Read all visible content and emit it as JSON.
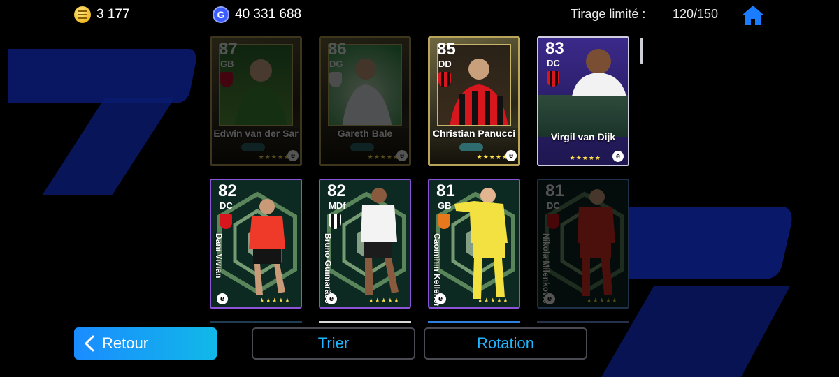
{
  "topbar": {
    "coins": "3 177",
    "gp": "40 331 688",
    "draw_label": "Tirage limité :",
    "draw_count": "120/150"
  },
  "icons": {
    "coin": "coin-icon",
    "gp": "gp-icon",
    "home": "home-icon",
    "back": "chevron-left-icon"
  },
  "cards": [
    {
      "rating": "87",
      "position": "GB",
      "name": "Edwin van der Sar",
      "style": "legend",
      "faded": true
    },
    {
      "rating": "86",
      "position": "DG",
      "name": "Gareth Bale",
      "style": "legend",
      "faded": true
    },
    {
      "rating": "85",
      "position": "DD",
      "name": "Christian Panucci",
      "style": "legend",
      "faded": false
    },
    {
      "rating": "83",
      "position": "DC",
      "name": "Virgil van Dijk",
      "style": "epic",
      "faded": false
    },
    {
      "rating": "82",
      "position": "DC",
      "name": "Dani Vivian",
      "style": "hex",
      "faded": false
    },
    {
      "rating": "82",
      "position": "MDf",
      "name": "Bruno Guimarães",
      "style": "hex",
      "faded": false
    },
    {
      "rating": "81",
      "position": "GB",
      "name": "Caoimhin Kelleher",
      "style": "hex",
      "faded": false
    },
    {
      "rating": "81",
      "position": "DC",
      "name": "Nikola Milenković",
      "style": "hex",
      "faded": true
    }
  ],
  "stars": "★★★★★",
  "e_logo": "e",
  "buttons": {
    "back": "Retour",
    "sort": "Trier",
    "rotation": "Rotation"
  },
  "colors": {
    "accent": "#1fb6ff",
    "back_button": "#1a8cff",
    "legend_gold": "#b9a45a",
    "hex_blue": "#5f95d9",
    "hex_purple": "#8b54d8",
    "home": "#1a7cff"
  }
}
